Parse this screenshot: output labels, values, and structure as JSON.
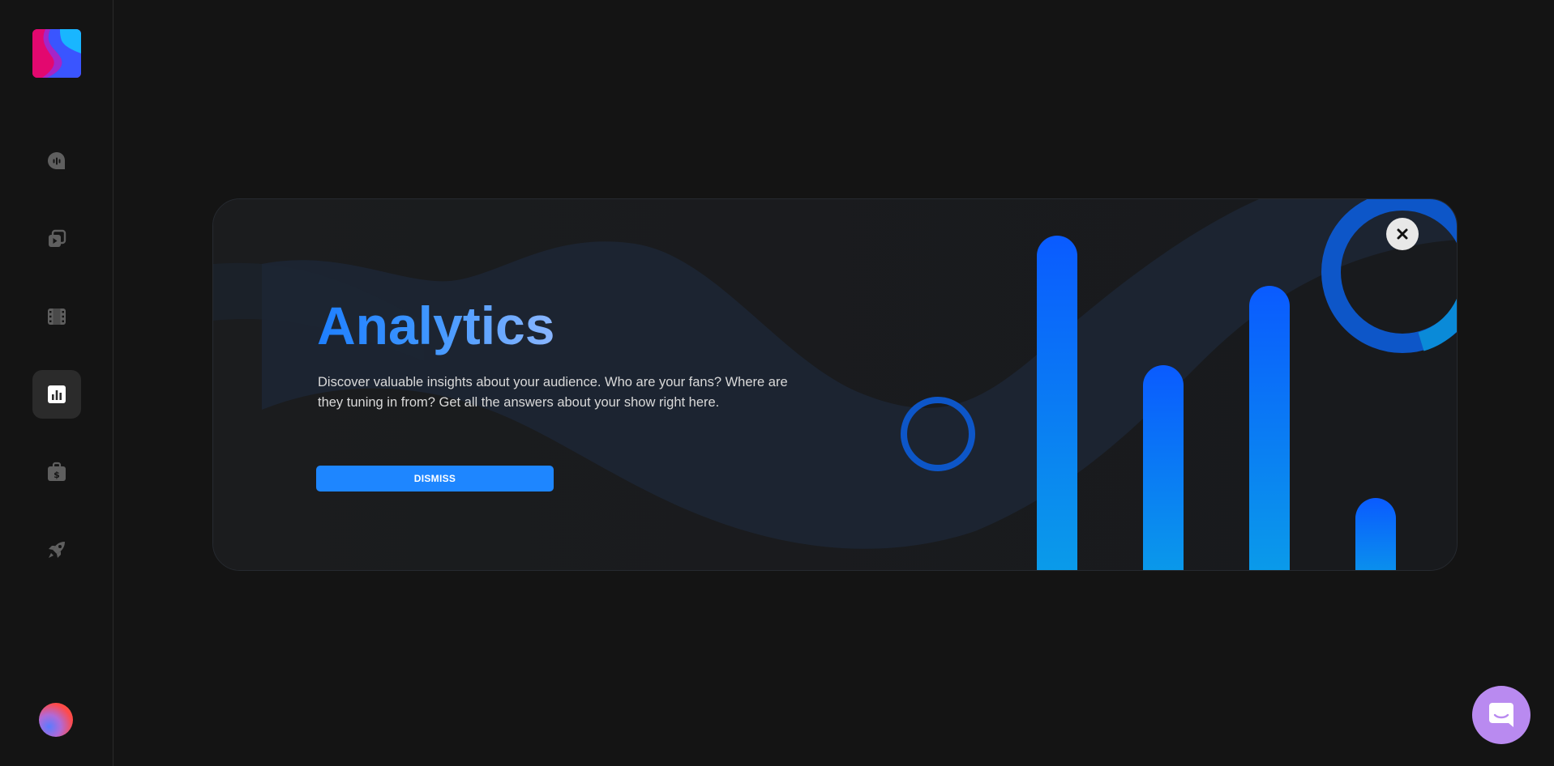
{
  "sidebar": {
    "logo": "app-logo",
    "items": [
      {
        "icon": "podcast-icon",
        "active": false
      },
      {
        "icon": "episodes-icon",
        "active": false
      },
      {
        "icon": "video-film-icon",
        "active": false
      },
      {
        "icon": "analytics-chart-icon",
        "active": true
      },
      {
        "icon": "monetization-briefcase-icon",
        "active": false
      },
      {
        "icon": "rocket-icon",
        "active": false
      }
    ],
    "avatar": "user-avatar"
  },
  "banner": {
    "title": "Analytics",
    "description": "Discover valuable insights about your audience. Who are your fans? Where are they tuning in from? Get all the answers about your show right here.",
    "dismiss_label": "DISMISS",
    "close_icon": "close-icon"
  },
  "chat": {
    "icon": "chat-icon"
  },
  "colors": {
    "background": "#141414",
    "accent": "#1e86ff",
    "title_gradient_start": "#1e7fff",
    "chat_launcher": "#b98af0"
  }
}
